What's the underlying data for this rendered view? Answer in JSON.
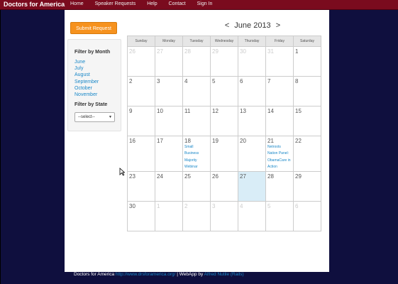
{
  "brand": "Doctors for America",
  "nav": [
    "Home",
    "Speaker Requests",
    "Help",
    "Contact",
    "Sign In"
  ],
  "submit_button": "Submit Request",
  "sidebar": {
    "filter_month_label": "Filter by Month",
    "months": [
      "June",
      "July",
      "August",
      "September",
      "October",
      "November"
    ],
    "filter_state_label": "Filter by State",
    "state_select_value": "--select--"
  },
  "calendar": {
    "prev": "<",
    "next": ">",
    "title": "June 2013",
    "days": [
      "Sunday",
      "Monday",
      "Tuesday",
      "Wednesday",
      "Thursday",
      "Friday",
      "Saturday"
    ],
    "weeks": [
      [
        {
          "d": "26",
          "other": true
        },
        {
          "d": "27",
          "other": true
        },
        {
          "d": "28",
          "other": true
        },
        {
          "d": "29",
          "other": true
        },
        {
          "d": "30",
          "other": true
        },
        {
          "d": "31",
          "other": true
        },
        {
          "d": "1"
        }
      ],
      [
        {
          "d": "2"
        },
        {
          "d": "3"
        },
        {
          "d": "4"
        },
        {
          "d": "5"
        },
        {
          "d": "6"
        },
        {
          "d": "7"
        },
        {
          "d": "8"
        }
      ],
      [
        {
          "d": "9"
        },
        {
          "d": "10"
        },
        {
          "d": "11"
        },
        {
          "d": "12"
        },
        {
          "d": "13"
        },
        {
          "d": "14"
        },
        {
          "d": "15"
        }
      ],
      [
        {
          "d": "16"
        },
        {
          "d": "17"
        },
        {
          "d": "18",
          "events": [
            "Small",
            "Business",
            "Majority",
            "Webinar"
          ]
        },
        {
          "d": "19"
        },
        {
          "d": "20"
        },
        {
          "d": "21",
          "events": [
            "Netroots",
            "Nation Panel:",
            "ObamaCare in",
            "Action"
          ]
        },
        {
          "d": "22"
        }
      ],
      [
        {
          "d": "23"
        },
        {
          "d": "24"
        },
        {
          "d": "25"
        },
        {
          "d": "26"
        },
        {
          "d": "27",
          "today": true
        },
        {
          "d": "28"
        },
        {
          "d": "29"
        }
      ],
      [
        {
          "d": "30"
        },
        {
          "d": "1",
          "other": true
        },
        {
          "d": "2",
          "other": true
        },
        {
          "d": "3",
          "other": true
        },
        {
          "d": "4",
          "other": true
        },
        {
          "d": "5",
          "other": true
        },
        {
          "d": "6",
          "other": true
        }
      ]
    ]
  },
  "footer": {
    "prefix": "Doctors for America",
    "url": "http://www.drsforamerica.org/",
    "middle": "| WebApp by",
    "author": "Alfred Nutile (Rails)"
  }
}
